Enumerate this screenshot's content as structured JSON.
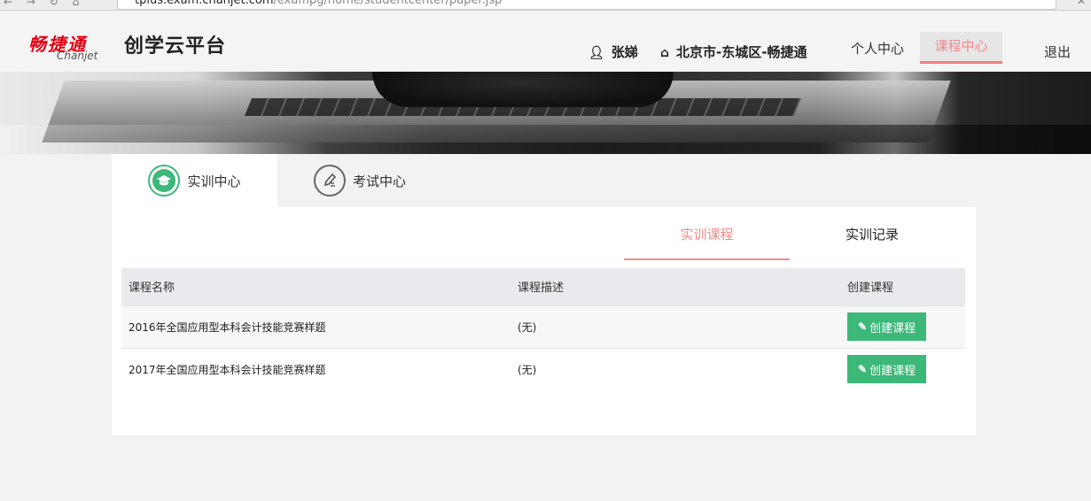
{
  "browser": {
    "url_host": "tplus.exam.chanjet.com",
    "url_path": "/exampg/home/studentcenter/paper.jsp"
  },
  "header": {
    "logo_cn": "畅捷通",
    "logo_en": "Chanjet",
    "platform_name": "创学云平台",
    "user_name": "张娣",
    "user_icon": "person-icon",
    "location": "北京市-东城区-畅捷通",
    "location_icon": "home-icon",
    "nav": {
      "personal_center": "个人中心",
      "course_center": "课程中心",
      "logout": "退出"
    }
  },
  "main_tabs": {
    "training": {
      "label": "实训中心",
      "icon": "graduation-cap-icon"
    },
    "exam": {
      "label": "考试中心",
      "icon": "pen-icon"
    }
  },
  "sub_tabs": {
    "courses": "实训课程",
    "records": "实训记录"
  },
  "table": {
    "headers": [
      "课程名称",
      "课程描述",
      "创建课程"
    ],
    "rows": [
      {
        "name": "2016年全国应用型本科会计技能竞赛样题",
        "desc": "(无)",
        "action": "创建课程"
      },
      {
        "name": "2017年全国应用型本科会计技能竞赛样题",
        "desc": "(无)",
        "action": "创建课程"
      }
    ]
  },
  "colors": {
    "accent_red": "#f08a8a",
    "green": "#3cb878",
    "brand_red": "#e60012"
  }
}
